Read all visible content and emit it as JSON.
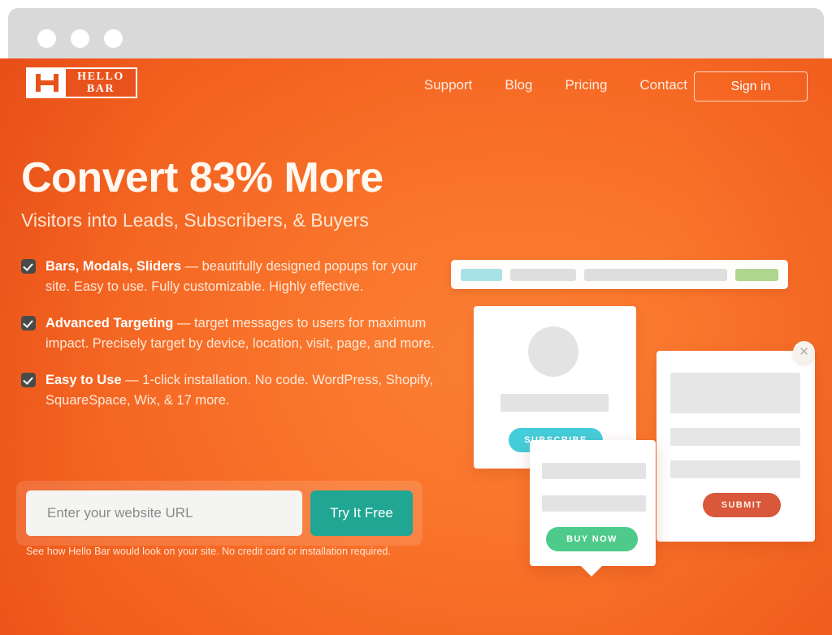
{
  "browser": {
    "dots": [
      "window-dot-1",
      "window-dot-2",
      "window-dot-3"
    ]
  },
  "header": {
    "logo": {
      "mark": "H",
      "line1": "HELLO",
      "line2": "BAR"
    },
    "nav": [
      {
        "label": "Support"
      },
      {
        "label": "Blog"
      },
      {
        "label": "Pricing"
      },
      {
        "label": "Contact"
      }
    ],
    "signin_label": "Sign in"
  },
  "hero": {
    "headline": "Convert 83% More",
    "subheadline": "Visitors into Leads, Subscribers, & Buyers",
    "features": [
      {
        "title": "Bars, Modals, Sliders",
        "body": " — beautifully designed popups for your site. Easy to use. Fully customizable. Highly effective."
      },
      {
        "title": "Advanced Targeting",
        "body": " — target messages to users for maximum impact. Precisely target by device, location, visit, page, and more."
      },
      {
        "title": "Easy to Use",
        "body": " — 1-click installation. No code. WordPress, Shopify, SquareSpace, Wix, & 17 more."
      }
    ]
  },
  "signup": {
    "placeholder": "Enter your website URL",
    "value": "",
    "cta_label": "Try It Free",
    "note": "See how Hello Bar would look on your site. No credit card or installation required."
  },
  "illustration": {
    "bar_mock": {
      "pills": [
        "teal",
        "gray",
        "gray",
        "green"
      ]
    },
    "card_main": {
      "button_label": "SUBSCRIBE"
    },
    "card_right": {
      "button_label": "SUBMIT",
      "close_icon": "close-x-icon"
    },
    "popup": {
      "button_label": "BUY NOW"
    }
  },
  "colors": {
    "brand_orange": "#f4621f",
    "orange_light": "#fb8034",
    "orange_dark": "#ec5418",
    "teal_cta": "#21a694",
    "subscribe_cyan": "#44cdda",
    "buy_green": "#4ecb8a",
    "submit_red": "#d9573a",
    "checkbox_dark": "#4a4a4a",
    "chrome_gray": "#d9d9d9"
  }
}
